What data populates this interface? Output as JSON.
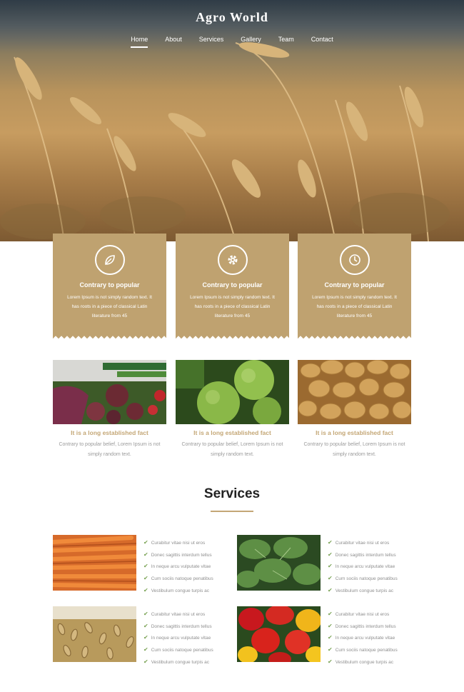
{
  "header": {
    "brand": "Agro World",
    "nav": [
      "Home",
      "About",
      "Services",
      "Gallery",
      "Team",
      "Contact"
    ]
  },
  "features": [
    {
      "icon": "leaf-icon",
      "title": "Contrary to popular",
      "text": "Lorem Ipsum is not simply random text. It has roots in a piece of classical Latin literature from 45"
    },
    {
      "icon": "gear-icon",
      "title": "Contrary to popular",
      "text": "Lorem Ipsum is not simply random text. It has roots in a piece of classical Latin literature from 45"
    },
    {
      "icon": "clock-icon",
      "title": "Contrary to popular",
      "text": "Lorem Ipsum is not simply random text. It has roots in a piece of classical Latin literature from 45"
    }
  ],
  "products": [
    {
      "title": "It is a long established fact",
      "text": "Contrary to popular belief, Lorem Ipsum is not simply random text."
    },
    {
      "title": "It is a long established fact",
      "text": "Contrary to popular belief, Lorem Ipsum is not simply random text."
    },
    {
      "title": "It is a long established fact",
      "text": "Contrary to popular belief, Lorem Ipsum is not simply random text."
    }
  ],
  "services": {
    "title": "Services",
    "blocks": [
      {
        "items": [
          "Curabitur vitae nisi ut eros",
          "Donec sagittis interdum tellus",
          "In neque arcu vulputate vitae",
          "Cum sociis natoque penatibus",
          "Vestibulum congue turpis ac"
        ]
      },
      {
        "items": [
          "Curabitur vitae nisi ut eros",
          "Donec sagittis interdum tellus",
          "In neque arcu vulputate vitae",
          "Cum sociis natoque penatibus",
          "Vestibulum congue turpis ac"
        ]
      },
      {
        "items": [
          "Curabitur vitae nisi ut eros",
          "Donec sagittis interdum tellus",
          "In neque arcu vulputate vitae",
          "Cum sociis natoque penatibus",
          "Vestibulum congue turpis ac"
        ]
      },
      {
        "items": [
          "Curabitur vitae nisi ut eros",
          "Donec sagittis interdum tellus",
          "In neque arcu vulputate vitae",
          "Cum sociis natoque penatibus",
          "Vestibulum congue turpis ac"
        ]
      }
    ]
  },
  "colors": {
    "accent": "#bfa270",
    "accent_text": "#c4a776",
    "check": "#7aa355"
  }
}
